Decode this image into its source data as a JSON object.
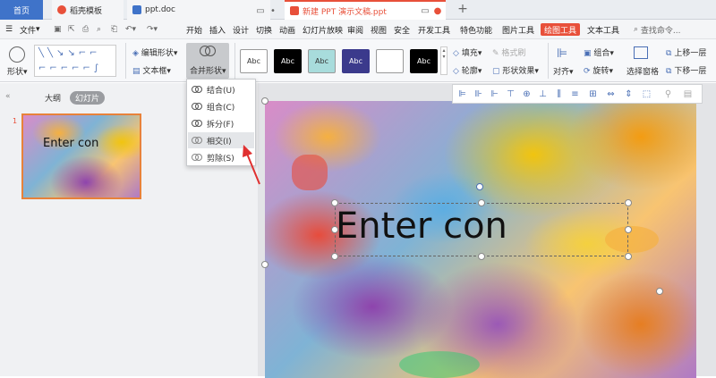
{
  "tabs": {
    "home": "首页",
    "template": "稻壳模板",
    "doc": "ppt.doc",
    "ppt": "新建 PPT 演示文稿.ppt",
    "add": "+"
  },
  "menu": {
    "file": "文件",
    "items": [
      "开始",
      "插入",
      "设计",
      "切换",
      "动画",
      "幻灯片放映",
      "审阅",
      "视图",
      "安全",
      "开发工具",
      "特色功能",
      "图片工具"
    ],
    "active": "绘图工具",
    "text_tool": "文本工具",
    "search": "查找命令..."
  },
  "toolbar": {
    "shape_label": "形状",
    "edit_shape": "编辑形状",
    "text_box": "文本框",
    "merge_shape": "合并形状",
    "style_text": "Abc",
    "fill": "填充",
    "format_brush": "格式刷",
    "outline": "轮廓",
    "shape_effect": "形状效果",
    "align": "对齐",
    "group": "组合",
    "rotate": "旋转",
    "selection_pane": "选择窗格",
    "bring_forward": "上移一层",
    "send_backward": "下移一层"
  },
  "styles": {
    "fills": [
      "#ffffff",
      "#000000",
      "#a8dcdc",
      "#3b3a8c",
      "#ffffff",
      "#000000"
    ],
    "text_colors": [
      "#000000",
      "#ffffff",
      "#000000",
      "#ffffff",
      "#000000",
      "#ffffff"
    ]
  },
  "sidebar": {
    "outline_tab": "大纲",
    "slides_tab": "幻灯片",
    "slide_number": "1",
    "thumb_text": "Enter con"
  },
  "slide": {
    "text": "Enter con"
  },
  "dropdown": {
    "items": [
      "结合(U)",
      "组合(C)",
      "拆分(F)",
      "相交(I)",
      "剪除(S)"
    ]
  },
  "colors": {
    "active_tab": "#e8503a",
    "accent_blue": "#4a6fb5",
    "arrow": "#e03030"
  }
}
